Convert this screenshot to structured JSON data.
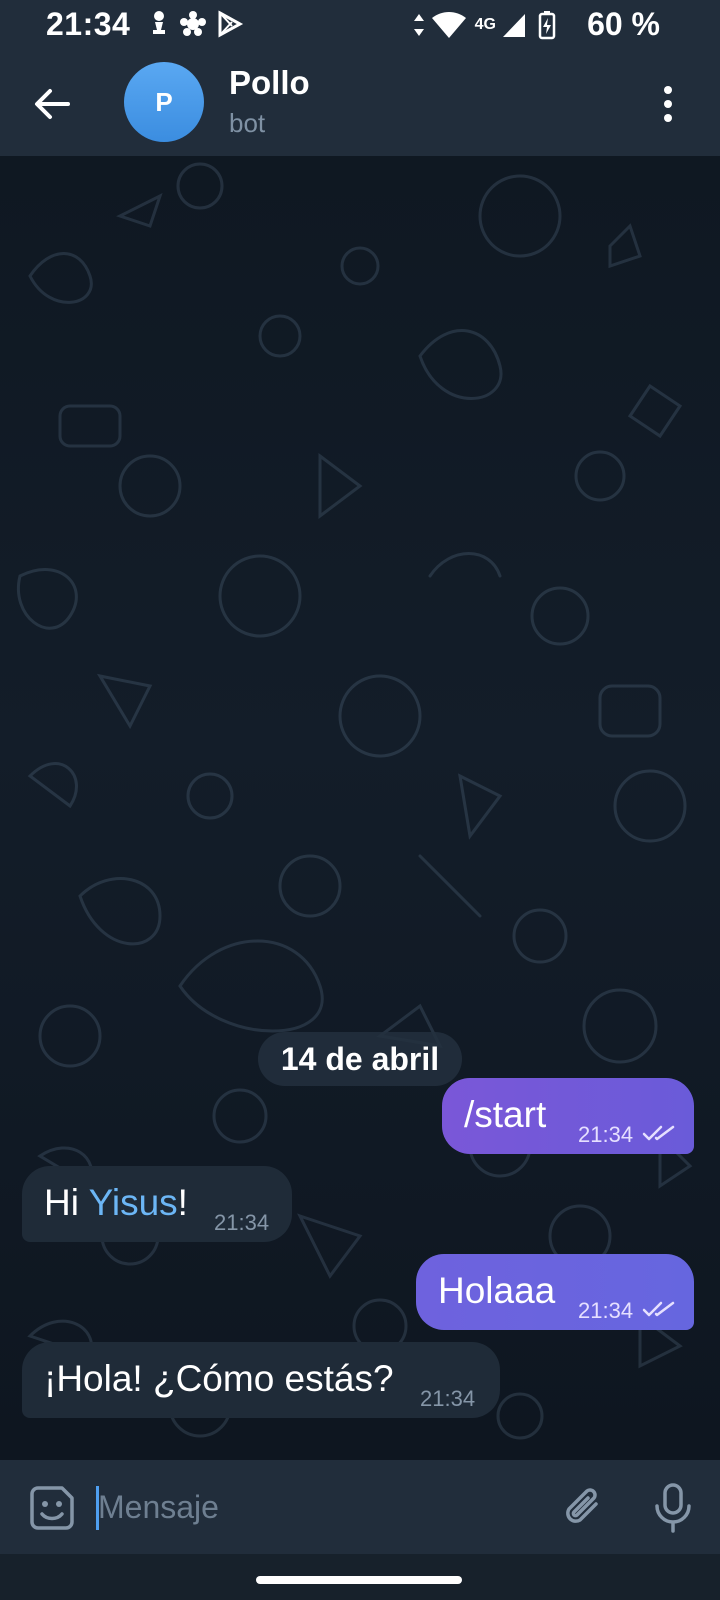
{
  "status_bar": {
    "time": "21:34",
    "network": "4G",
    "battery": "60 %",
    "icons": [
      "chess-pawn-icon",
      "flower-icon",
      "play-store-icon",
      "data-arrows-icon",
      "wifi-icon",
      "signal-icon",
      "battery-charging-icon"
    ]
  },
  "header": {
    "avatar_letter": "P",
    "title": "Pollo",
    "subtitle": "bot",
    "avatar_color": "#4a9be8"
  },
  "chat": {
    "date": "14 de abril",
    "messages": [
      {
        "dir": "out",
        "text": "/start",
        "time": "21:34",
        "status": "read"
      },
      {
        "dir": "in",
        "text_prefix": "Hi ",
        "mention": "Yisus",
        "text_suffix": "!",
        "time": "21:34"
      },
      {
        "dir": "out",
        "text": "Holaaa",
        "time": "21:34",
        "status": "read"
      },
      {
        "dir": "in",
        "text": "¡Hola! ¿Cómo estás?",
        "time": "21:34"
      }
    ]
  },
  "composer": {
    "placeholder": "Mensaje",
    "value": ""
  },
  "colors": {
    "header_bg": "#212d3b",
    "chat_bg": "#131d29",
    "outgoing_bubble": "#7156d9",
    "incoming_bubble": "#1f2b38",
    "mention": "#6cb6f5",
    "accent": "#4f9ff0"
  }
}
